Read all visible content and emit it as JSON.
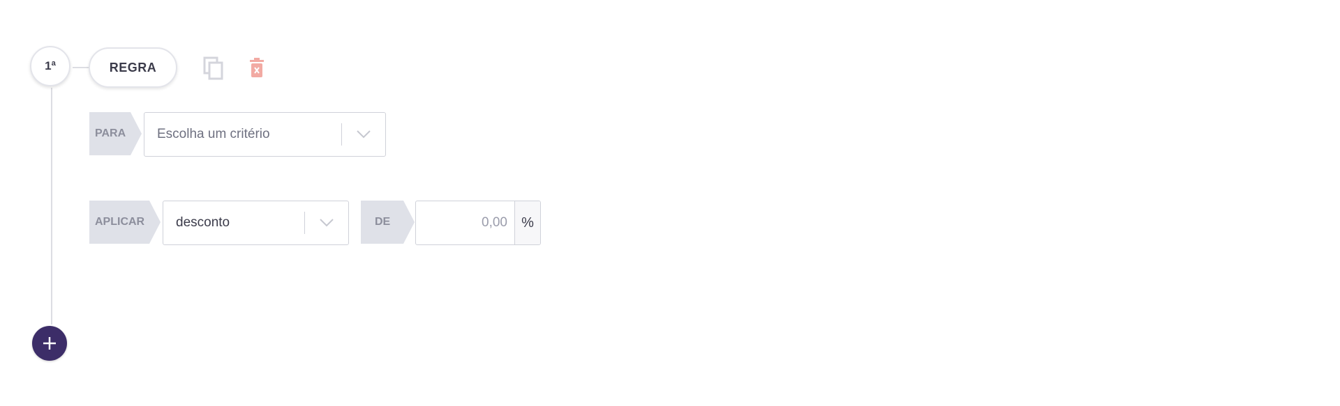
{
  "rule": {
    "number": "1ª",
    "label": "REGRA",
    "copy_icon": "copy-icon",
    "delete_icon": "delete-icon"
  },
  "criteria": {
    "tag": "PARA",
    "placeholder": "Escolha um critério",
    "arrow_icon": "chevron-down-icon"
  },
  "apply": {
    "tag": "APLICAR",
    "selected": "desconto",
    "arrow_icon": "chevron-down-icon",
    "value_tag": "DE",
    "value_placeholder": "0,00",
    "value_unit": "%"
  },
  "add_button": {
    "icon": "plus-icon"
  },
  "colors": {
    "accent": "#3c2d68",
    "delete": "#f2aaa3",
    "tag_bg": "#dfe1e8",
    "border": "#cfd1d9"
  }
}
